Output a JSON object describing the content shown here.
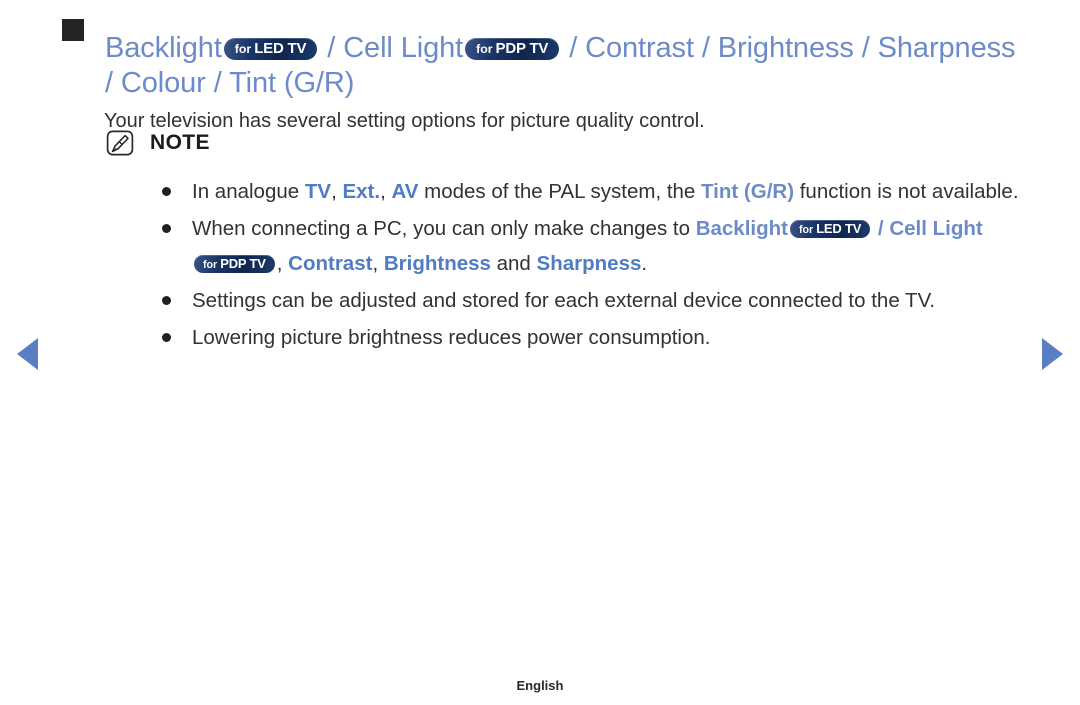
{
  "nav": {
    "prev_label": "Previous page",
    "next_label": "Next page",
    "prev_icon": "triangle-left-icon",
    "next_icon": "triangle-right-icon"
  },
  "heading": {
    "marker": "square-bullet-marker",
    "part1": "Backlight",
    "badge1": {
      "for": "for",
      "name": "LED TV"
    },
    "sep1": " / ",
    "part2": "Cell Light",
    "badge2": {
      "for": "for",
      "name": "PDP TV"
    },
    "sep2": " / ",
    "part3": "Contrast / Brightness / Sharpness / Colour / Tint (G/R)"
  },
  "intro": "Your television has several setting options for picture quality control.",
  "note": {
    "icon": "note-pencil-icon",
    "label": "NOTE",
    "items": [
      {
        "seg1": "In analogue ",
        "hl1": "TV",
        "seg2": ", ",
        "hl2": "Ext.",
        "seg3": ", ",
        "hl3": "AV",
        "seg4": " modes of the PAL system, the ",
        "hl4": "Tint (G/R)",
        "seg5": " function is not available."
      },
      {
        "seg1": "When connecting a PC, you can only make changes to ",
        "hl1": "Backlight",
        "badge1": {
          "for": "for",
          "name": "LED TV"
        },
        "seg2": " / ",
        "hl2": "Cell Light",
        "badge2": {
          "for": "for",
          "name": "PDP TV"
        },
        "seg3": ", ",
        "hl3": "Contrast",
        "seg4": ", ",
        "hl4": "Brightness",
        "seg5": " and ",
        "hl5": "Sharpness",
        "seg6": "."
      },
      {
        "text": "Settings can be adjusted and stored for each external device connected to the TV."
      },
      {
        "text": "Lowering picture brightness reduces power consumption."
      }
    ]
  },
  "footer": {
    "language": "English"
  },
  "colors": {
    "heading_blue": "#6d8bc9",
    "body_blue": "#4f7cc4",
    "badge_navy": "#12275a",
    "arrow_blue": "#5b7ec2",
    "text": "#323232"
  }
}
